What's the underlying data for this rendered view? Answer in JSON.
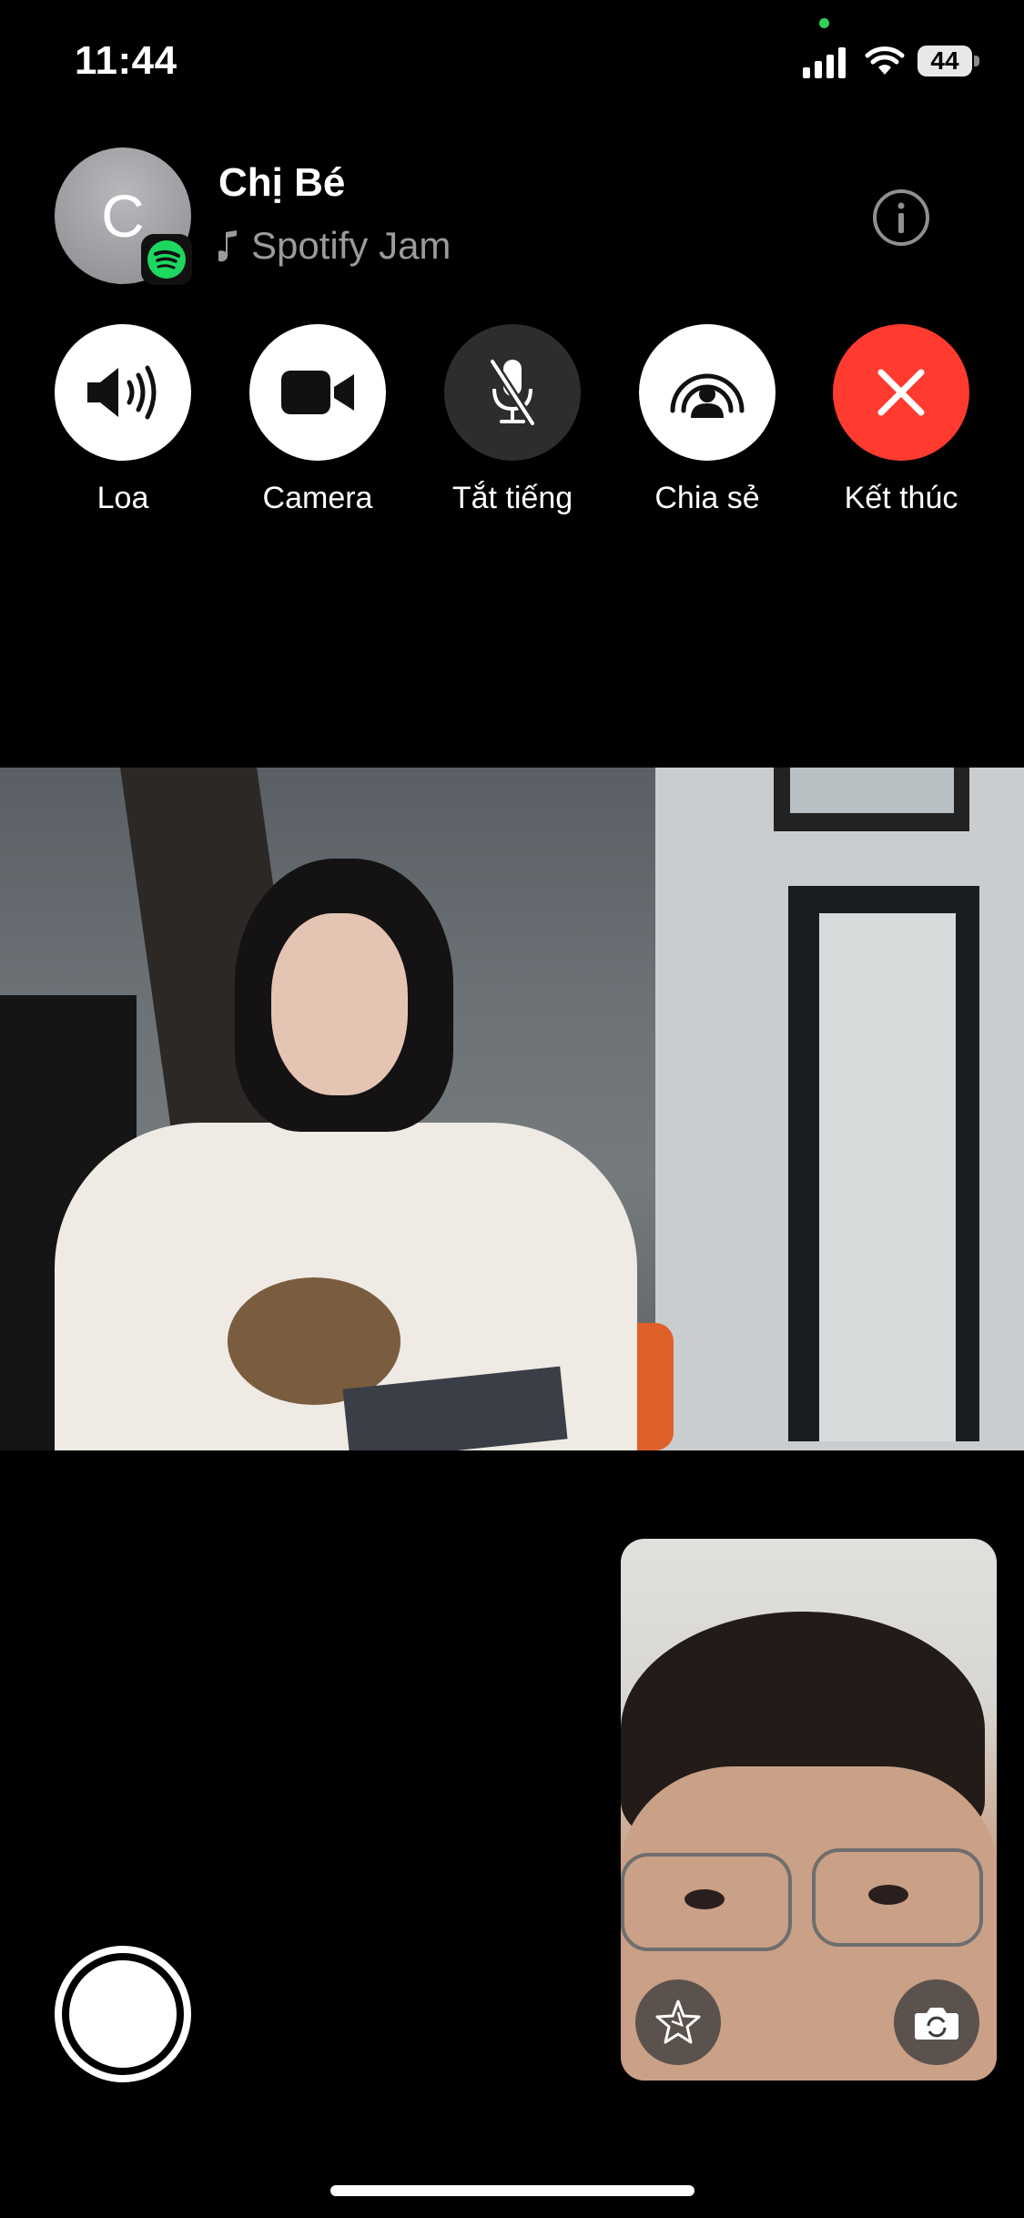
{
  "status_bar": {
    "time": "11:44",
    "battery": "44"
  },
  "call": {
    "avatar_initial": "C",
    "contact_name": "Chị Bé",
    "activity": "Spotify Jam"
  },
  "controls": [
    {
      "label": "Loa",
      "icon": "speaker-icon"
    },
    {
      "label": "Camera",
      "icon": "video-camera-icon"
    },
    {
      "label": "Tắt tiếng",
      "icon": "mic-off-icon"
    },
    {
      "label": "Chia sẻ",
      "icon": "shareplay-icon"
    },
    {
      "label": "Kết thúc",
      "icon": "close-icon"
    }
  ],
  "colors": {
    "end_call": "#ff3b30",
    "spotify_green": "#1ed760",
    "background": "#000000"
  }
}
